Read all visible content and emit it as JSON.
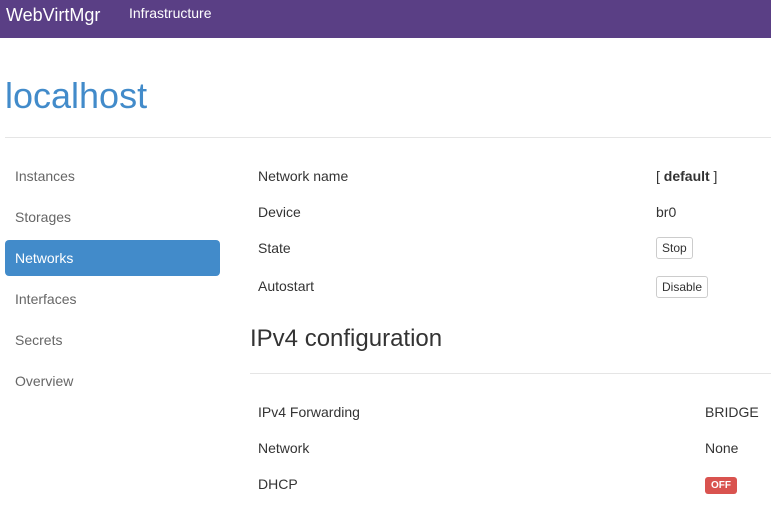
{
  "navbar": {
    "brand": "WebVirtMgr",
    "links": [
      "Infrastructure"
    ]
  },
  "page": {
    "title": "localhost"
  },
  "sidebar": {
    "items": [
      {
        "label": "Instances"
      },
      {
        "label": "Storages"
      },
      {
        "label": "Networks",
        "active": true
      },
      {
        "label": "Interfaces"
      },
      {
        "label": "Secrets"
      },
      {
        "label": "Overview"
      }
    ]
  },
  "network": {
    "name_label": "Network name",
    "name_bracket_open": "[ ",
    "name_value": "default",
    "name_bracket_close": " ]",
    "device_label": "Device",
    "device_value": "br0",
    "state_label": "State",
    "state_button": "Stop",
    "autostart_label": "Autostart",
    "autostart_button": "Disable"
  },
  "ipv4": {
    "section_title": "IPv4 configuration",
    "forwarding_label": "IPv4 Forwarding",
    "forwarding_value": "BRIDGE",
    "network_label": "Network",
    "network_value": "None",
    "dhcp_label": "DHCP",
    "dhcp_badge": "OFF",
    "dhcp_badge_color": "#d9534f"
  },
  "colors": {
    "navbar": "#5a3f85",
    "accent": "#428bca"
  }
}
